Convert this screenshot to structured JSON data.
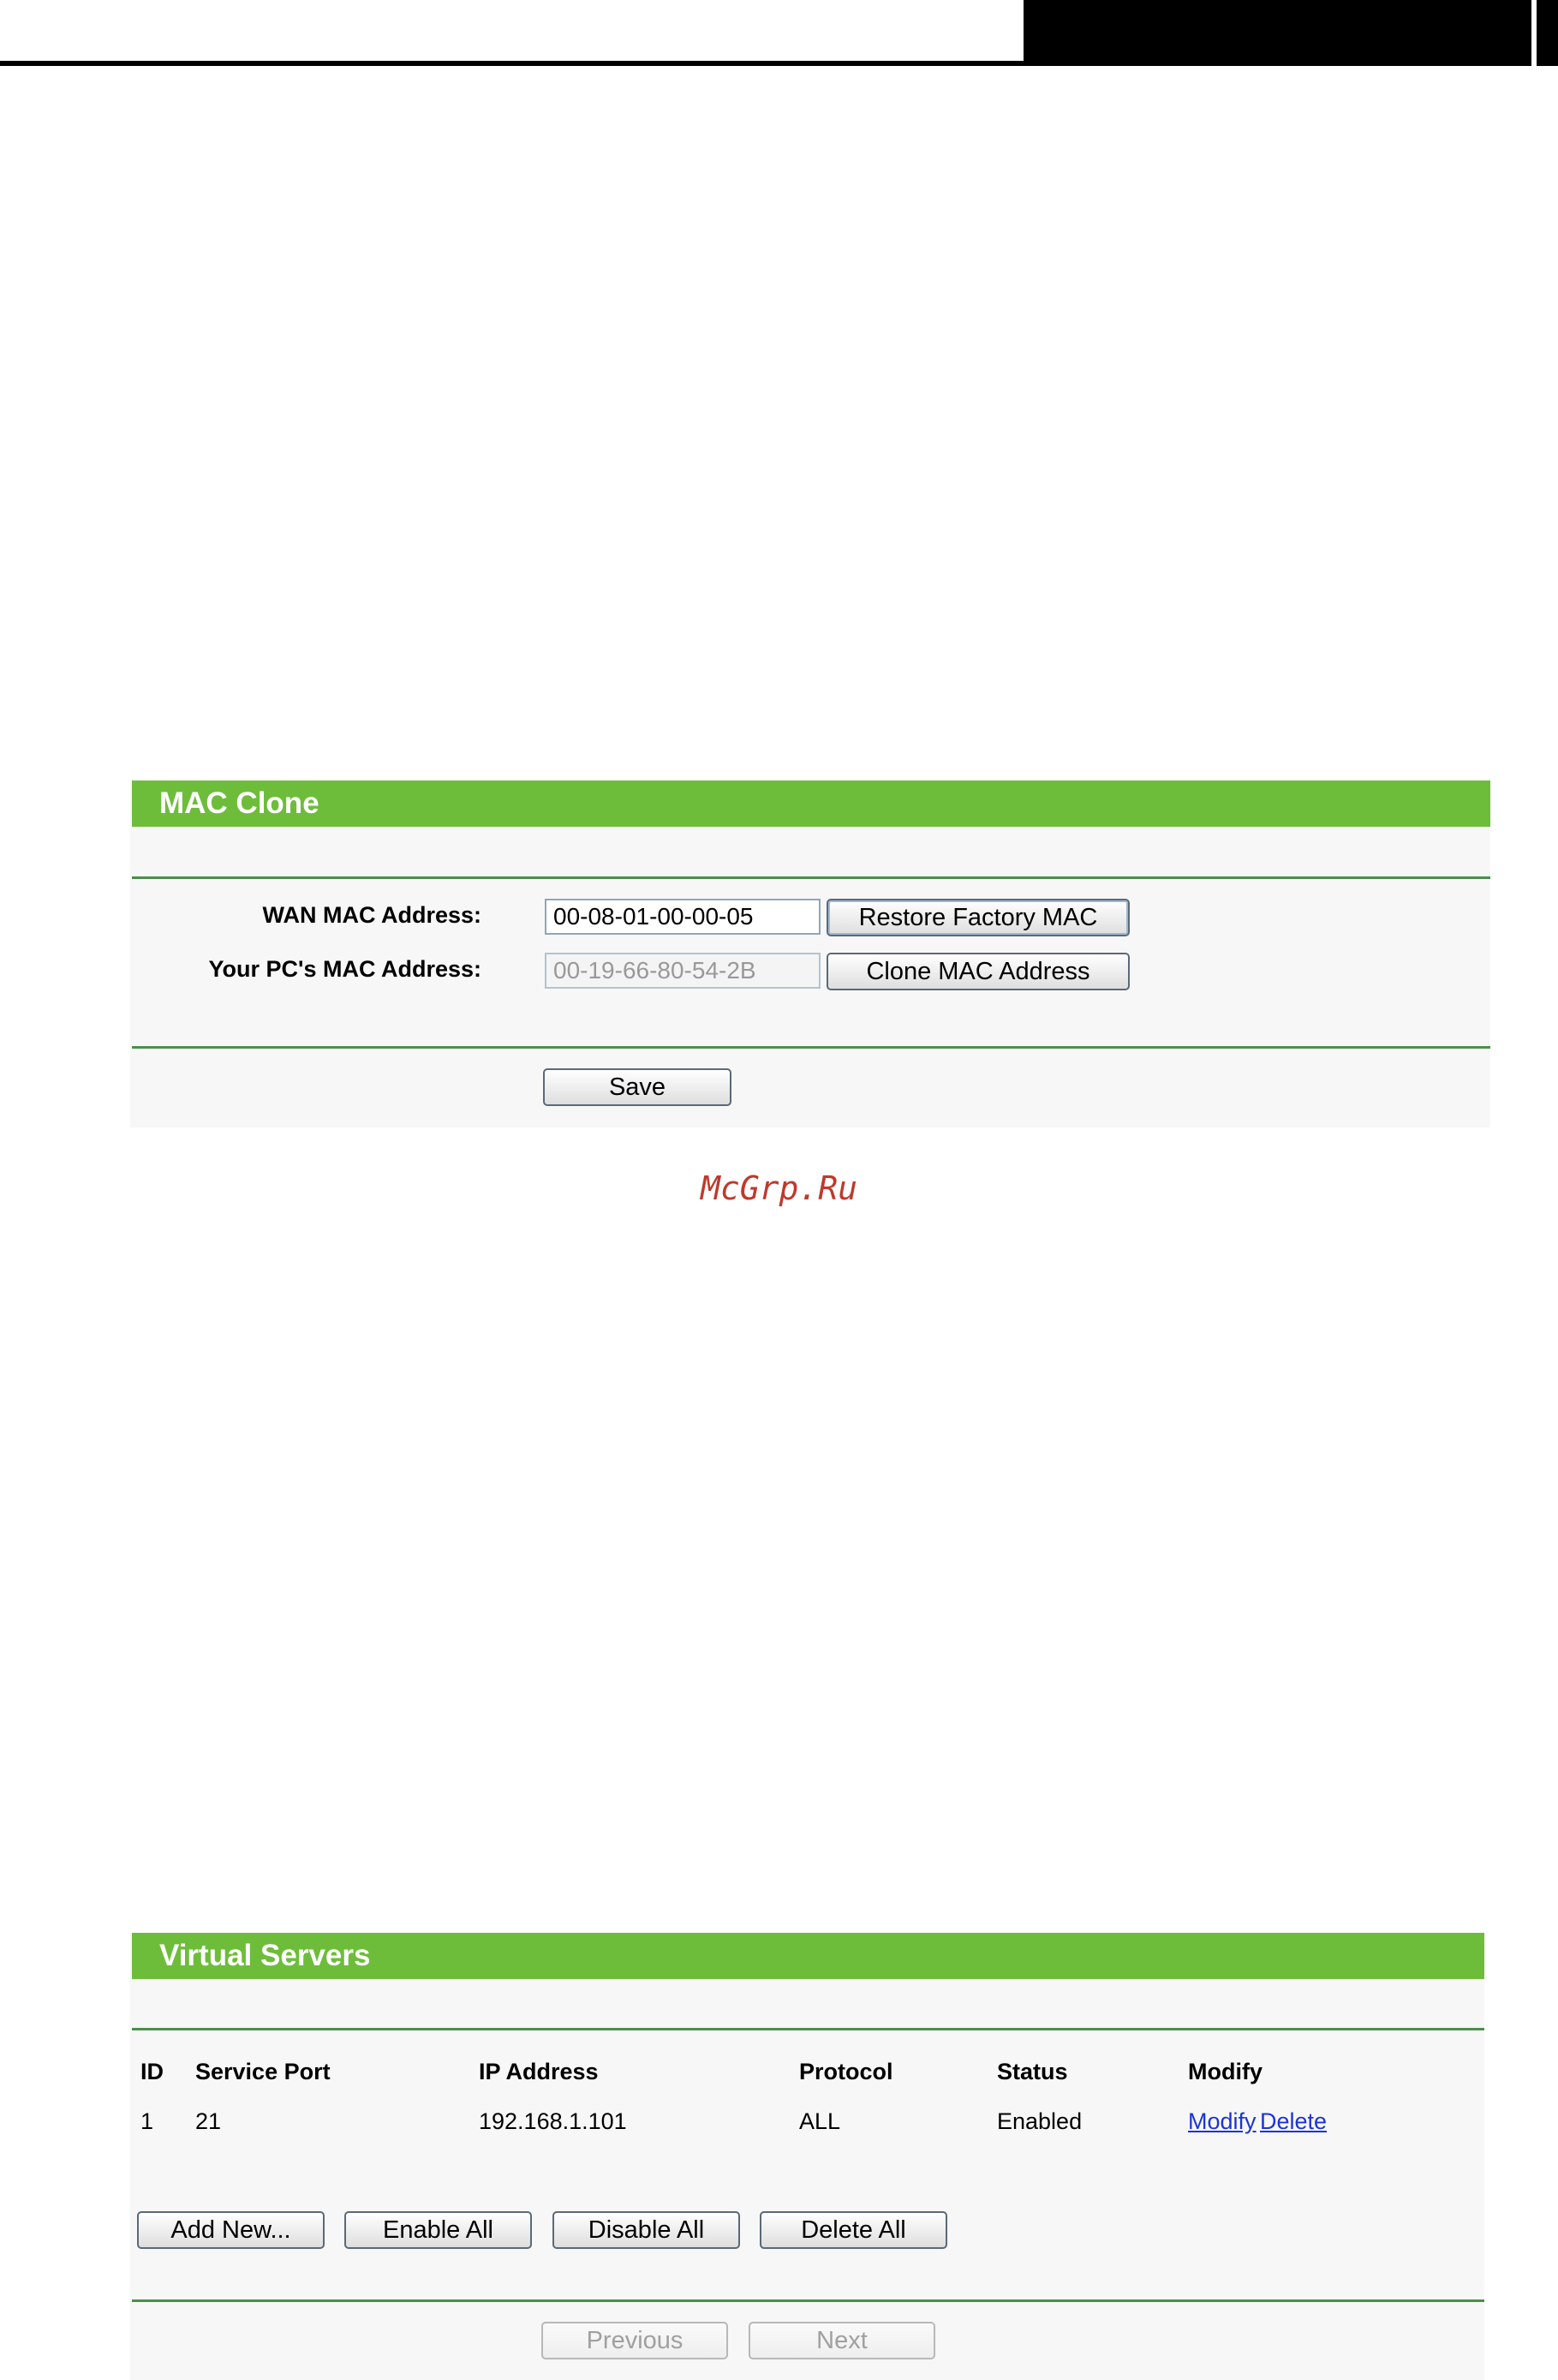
{
  "mac_clone": {
    "title": "MAC Clone",
    "wan_mac_label": "WAN MAC Address:",
    "wan_mac_value": "00-08-01-00-00-05",
    "restore_button": "Restore Factory MAC",
    "pc_mac_label": "Your PC's MAC Address:",
    "pc_mac_value": "00-19-66-80-54-2B",
    "clone_button": "Clone MAC Address",
    "save_button": "Save"
  },
  "watermark": "McGrp.Ru",
  "virtual_servers": {
    "title": "Virtual Servers",
    "columns": [
      "ID",
      "Service Port",
      "IP Address",
      "Protocol",
      "Status",
      "Modify"
    ],
    "rows": [
      {
        "id": "1",
        "service_port": "21",
        "ip_address": "192.168.1.101",
        "protocol": "ALL",
        "status": "Enabled",
        "modify_link": "Modify",
        "delete_link": "Delete"
      }
    ],
    "buttons": {
      "add_new": "Add New...",
      "enable_all": "Enable All",
      "disable_all": "Disable All",
      "delete_all": "Delete All"
    },
    "pager": {
      "previous": "Previous",
      "next": "Next"
    }
  },
  "colors": {
    "header_green": "#6ebd3a",
    "rule_green": "#4b8f4b",
    "link_blue": "#1a35d6",
    "watermark_red": "#c0392b"
  }
}
